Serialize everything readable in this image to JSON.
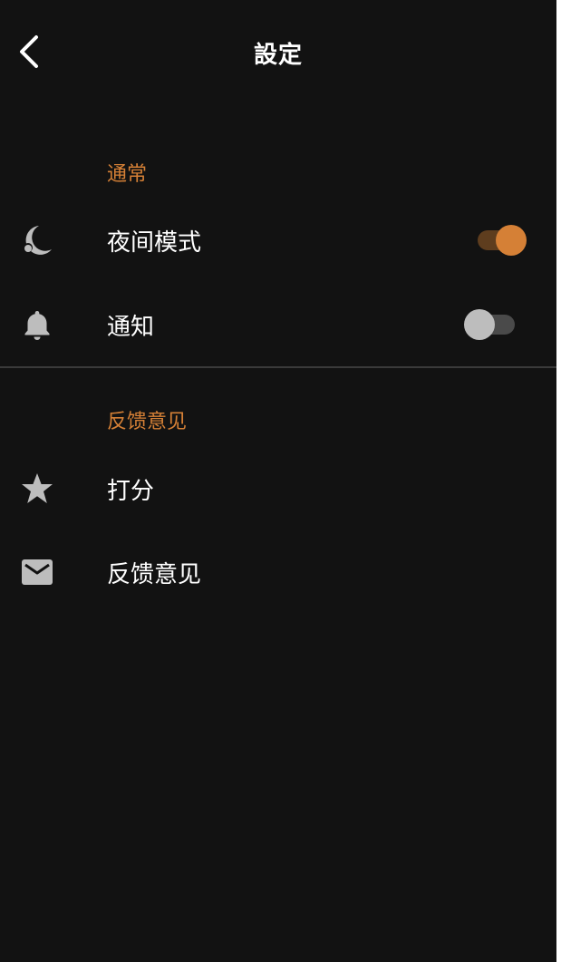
{
  "header": {
    "title": "設定",
    "back_icon": "chevron-left-icon"
  },
  "colors": {
    "background": "#121212",
    "accent": "#d58036",
    "text": "#ffffff",
    "icon": "#bdbdbd",
    "divider": "#3a3a3a"
  },
  "sections": [
    {
      "header": "通常",
      "items": [
        {
          "label": "夜间模式",
          "icon": "moon-icon",
          "toggle": true,
          "checked": true
        },
        {
          "label": "通知",
          "icon": "bell-icon",
          "toggle": true,
          "checked": false
        }
      ]
    },
    {
      "header": "反馈意见",
      "items": [
        {
          "label": "打分",
          "icon": "star-icon"
        },
        {
          "label": "反馈意见",
          "icon": "mail-icon"
        }
      ]
    }
  ]
}
